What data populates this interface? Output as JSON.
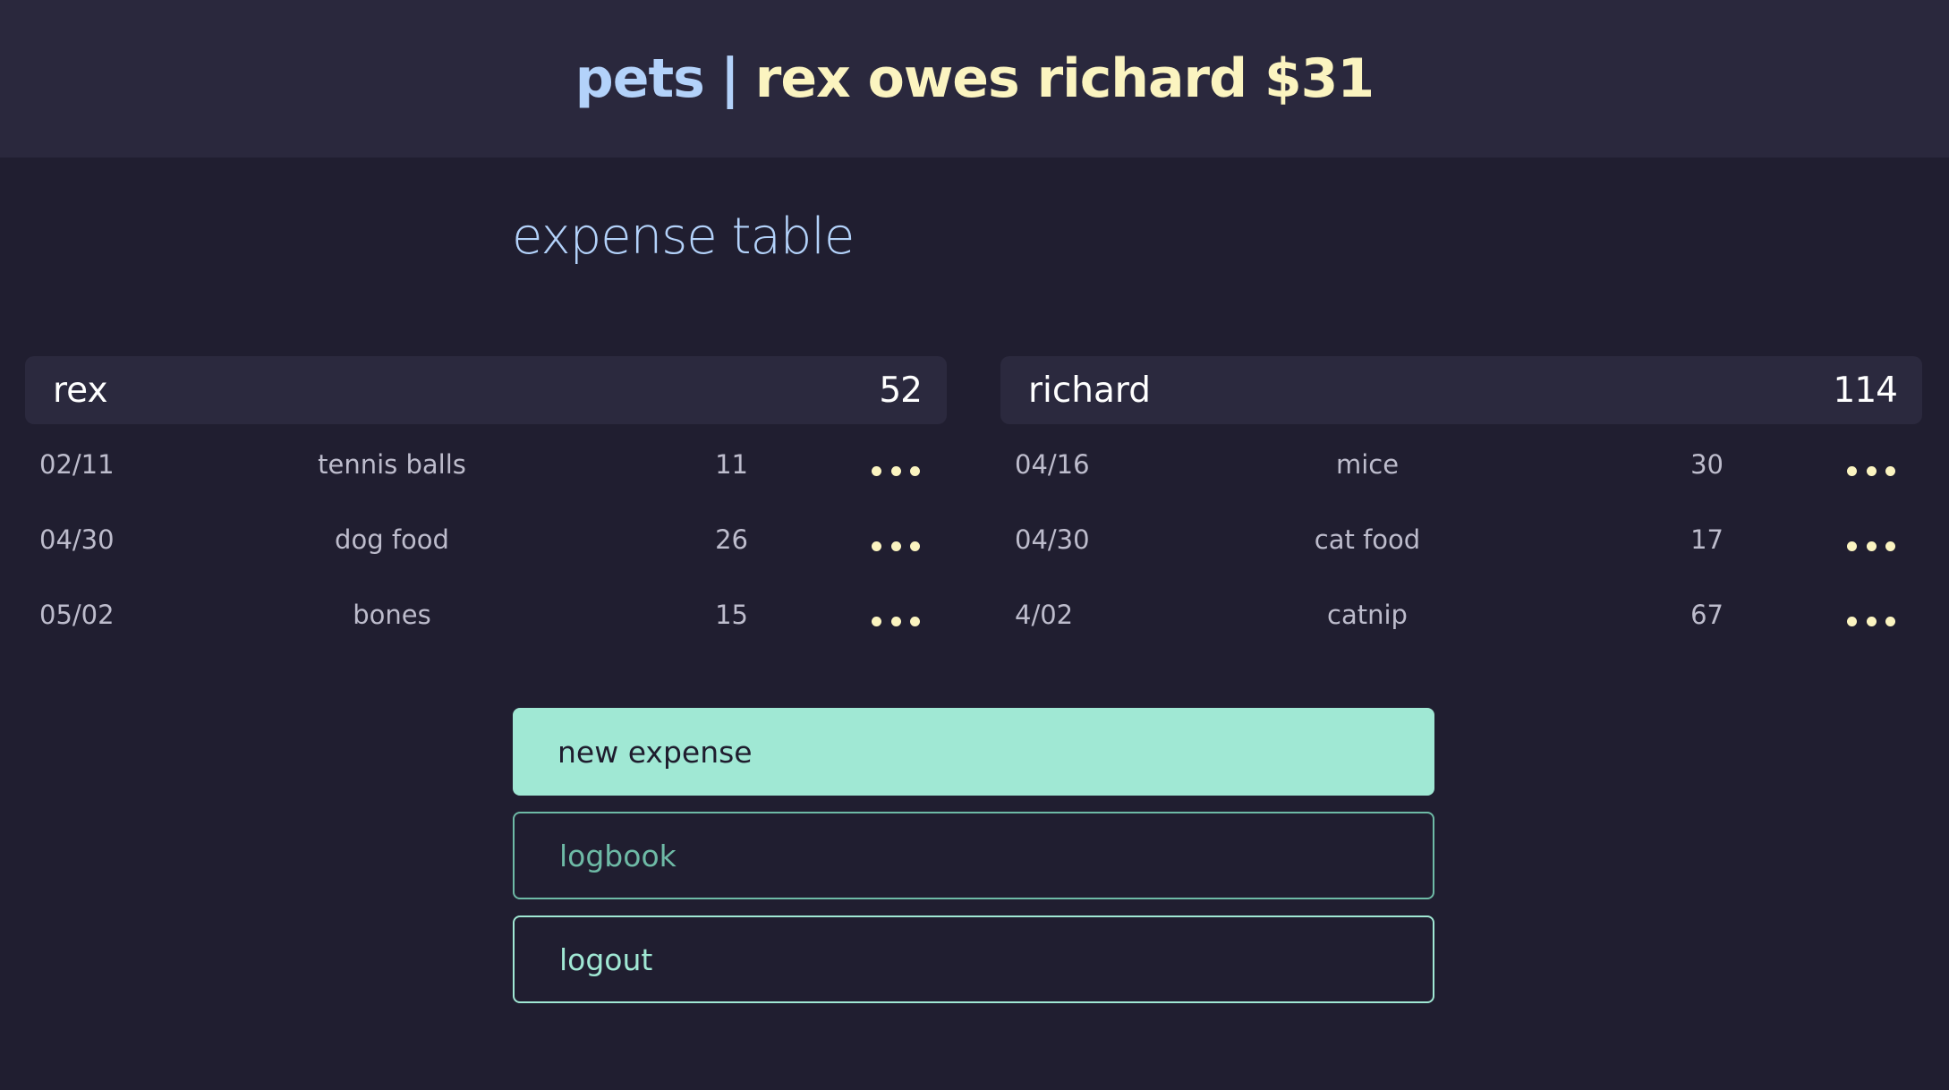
{
  "header": {
    "group": "pets",
    "separator": "|",
    "balance": "rex owes richard $31"
  },
  "section_title": "expense table",
  "columns": [
    {
      "name": "rex",
      "total": "52",
      "rows": [
        {
          "date": "02/11",
          "desc": "tennis balls",
          "amount": "11"
        },
        {
          "date": "04/30",
          "desc": "dog food",
          "amount": "26"
        },
        {
          "date": "05/02",
          "desc": "bones",
          "amount": "15"
        }
      ]
    },
    {
      "name": "richard",
      "total": "114",
      "rows": [
        {
          "date": "04/16",
          "desc": "mice",
          "amount": "30"
        },
        {
          "date": "04/30",
          "desc": "cat food",
          "amount": "17"
        },
        {
          "date": "4/02",
          "desc": "catnip",
          "amount": "67"
        }
      ]
    }
  ],
  "buttons": {
    "new_expense": "new expense",
    "logbook": "logbook",
    "logout": "logout"
  },
  "colors": {
    "background": "#201e30",
    "header_bg": "#2a283d",
    "accent_blue": "#b3d2fa",
    "accent_yellow": "#fbf4c0",
    "accent_mint": "#a0e8d4"
  },
  "icons": {
    "row_menu": "more-horizontal-icon"
  }
}
